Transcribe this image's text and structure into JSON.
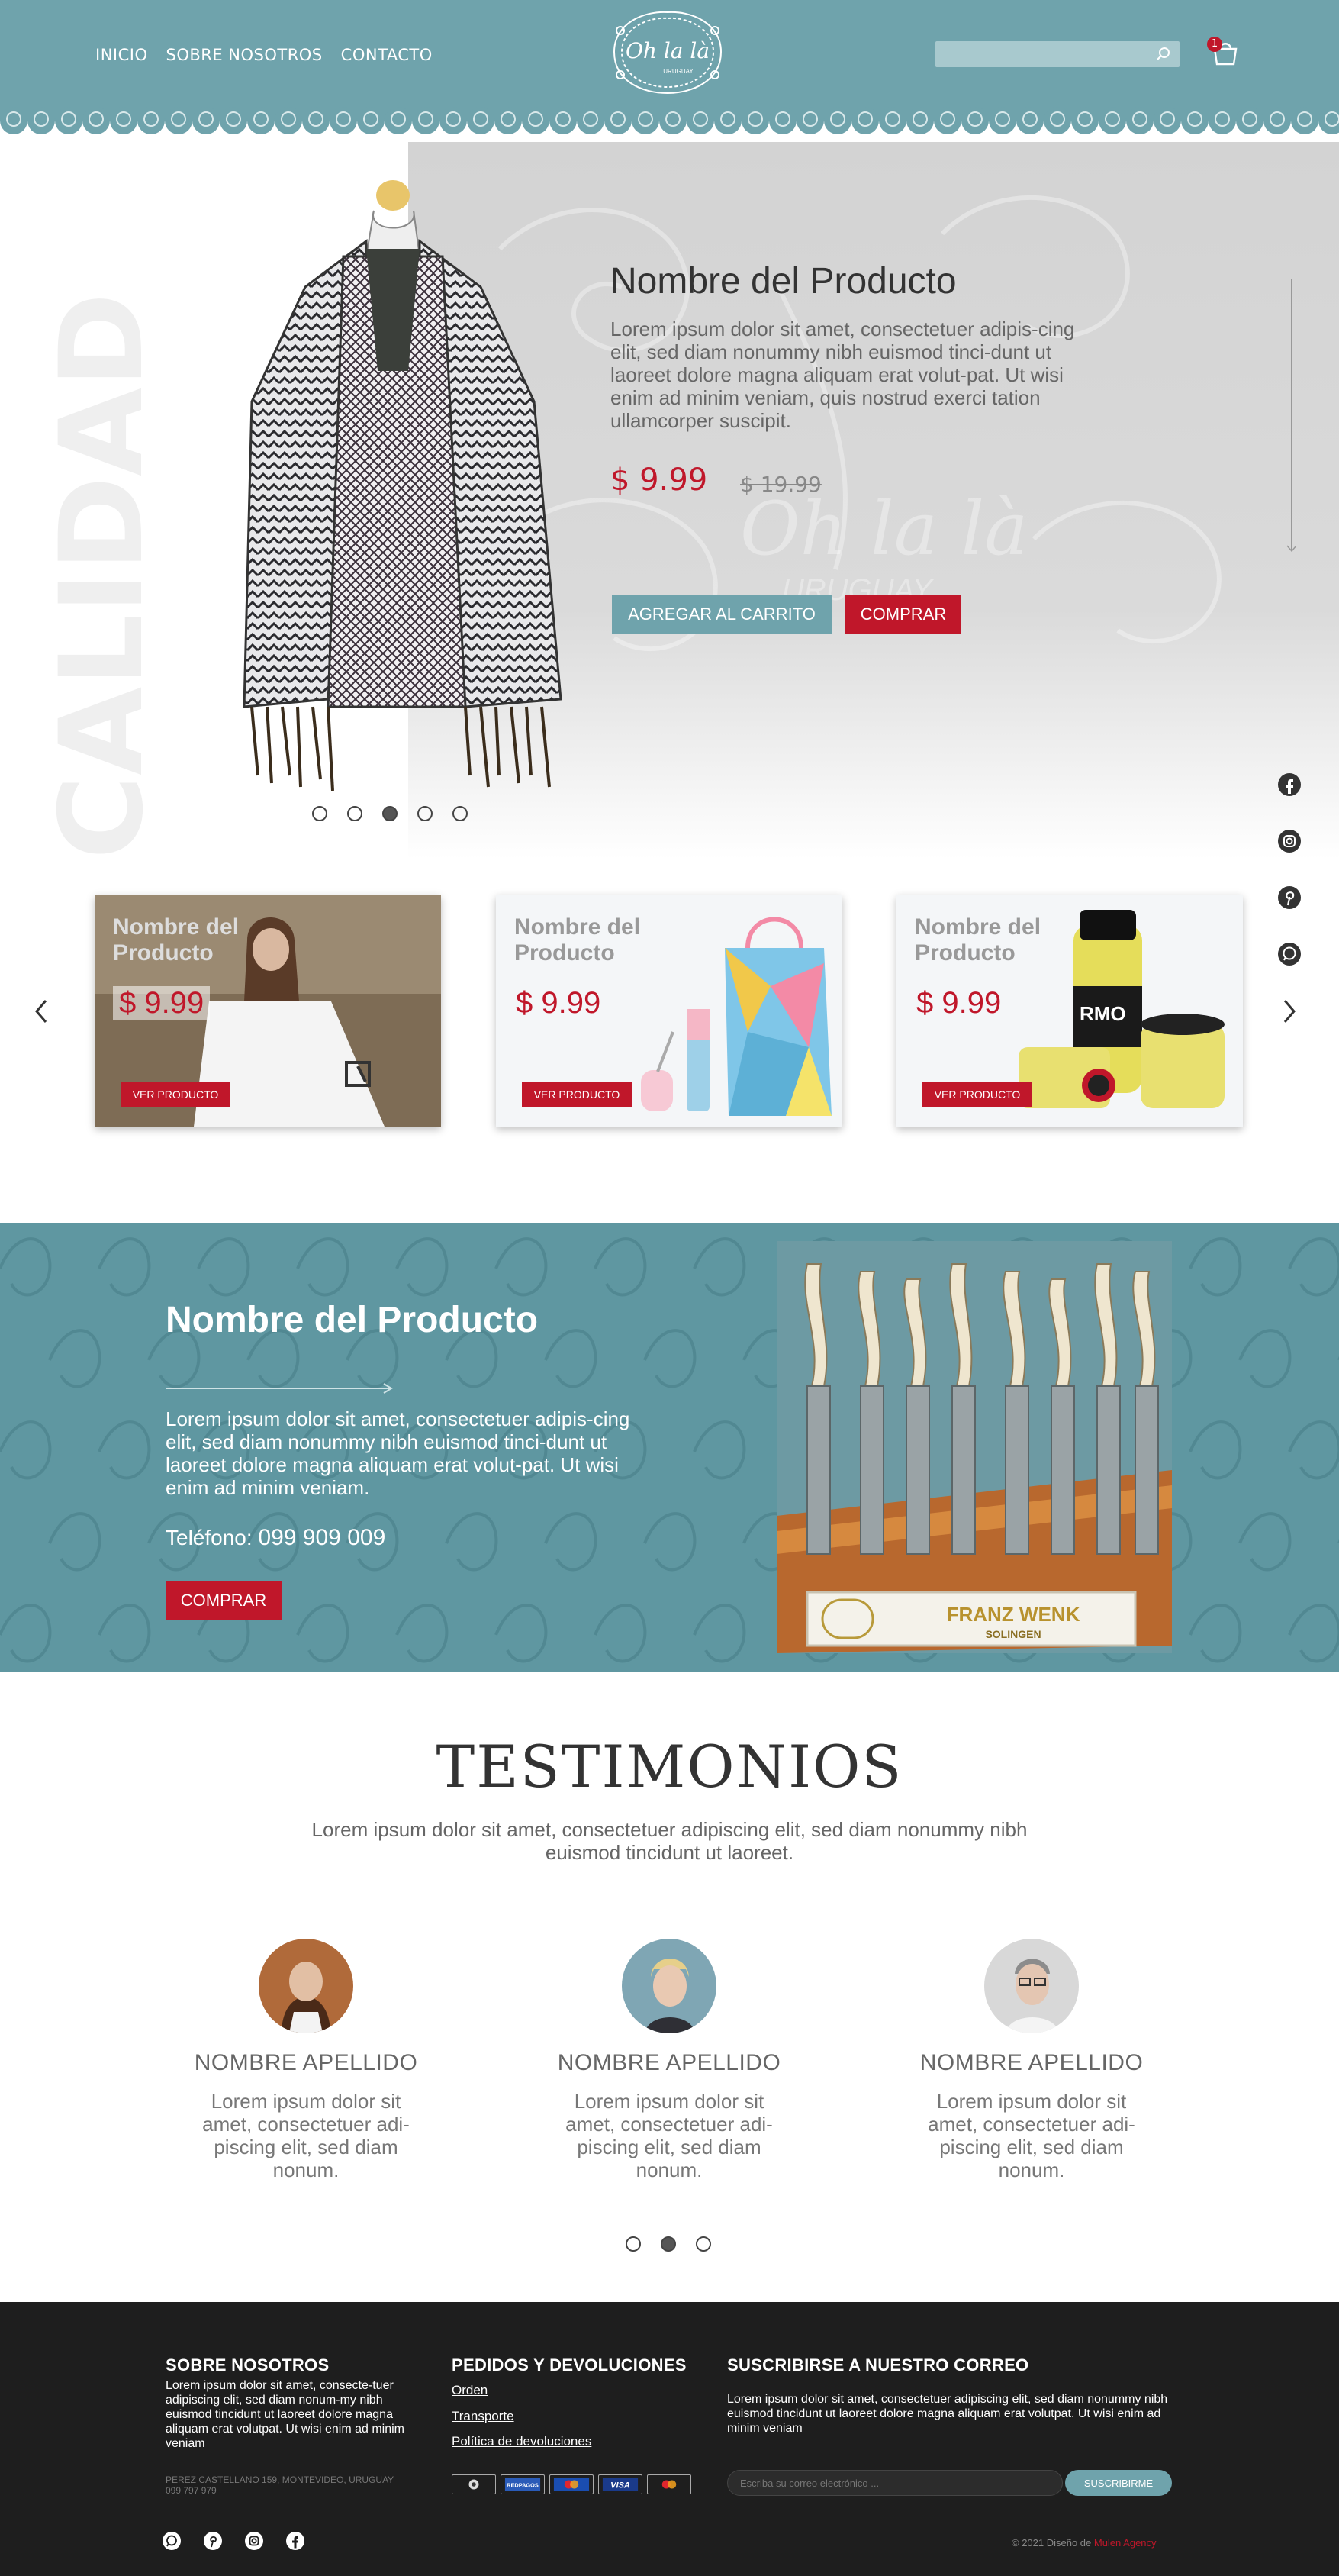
{
  "header": {
    "nav": [
      "INICIO",
      "SOBRE NOSOTROS",
      "CONTACTO"
    ],
    "logo_text": "Oh la là",
    "logo_sub": "URUGUAY",
    "search": {
      "placeholder": "",
      "icon": "search-icon"
    },
    "cart": {
      "count": "1",
      "icon": "shopping-bag-icon"
    }
  },
  "hero": {
    "side_word": "CALIDAD",
    "title": "Nombre del Producto",
    "description": "Lorem ipsum dolor sit amet, consectetuer adipis-cing elit, sed diam nonummy nibh euismod tinci-dunt ut laoreet dolore magna aliquam erat volut-pat. Ut wisi enim ad minim veniam, quis nostrud exerci tation ullamcorper suscipit.",
    "price": "$ 9.99",
    "old_price": "$ 19.99",
    "add_to_cart": "AGREGAR AL CARRITO",
    "buy": "COMPRAR",
    "watermark_text": "URUGUAY",
    "slides": 5,
    "active_slide": 3,
    "social": [
      "facebook-icon",
      "instagram-icon",
      "pinterest-icon",
      "whatsapp-icon"
    ]
  },
  "cards": [
    {
      "title": "Nombre del Producto",
      "price": "$ 9.99",
      "button": "VER PRODUCTO"
    },
    {
      "title": "Nombre del Producto",
      "price": "$ 9.99",
      "button": "VER PRODUCTO"
    },
    {
      "title": "Nombre del Producto",
      "price": "$ 9.99",
      "button": "VER PRODUCTO"
    }
  ],
  "feature": {
    "title": "Nombre del Producto",
    "description": "Lorem ipsum dolor sit amet, consectetuer adipis-cing elit, sed diam nonummy nibh euismod tinci-dunt ut laoreet dolore magna aliquam erat volut-pat. Ut wisi enim ad minim veniam.",
    "phone_label": "Teléfono: ",
    "phone": "099 909 009",
    "buy": "COMPRAR",
    "image_brand": "FRANZ WENK",
    "image_city": "SOLINGEN"
  },
  "testimonials": {
    "title": "TESTIMONIOS",
    "subtitle": "Lorem ipsum dolor sit amet, consectetuer adipiscing elit, sed diam nonummy nibh euismod tincidunt ut laoreet.",
    "people": [
      {
        "name": "NOMBRE APELLIDO",
        "text": "Lorem ipsum dolor sit amet, consectetuer adi-piscing elit, sed diam nonum."
      },
      {
        "name": "NOMBRE APELLIDO",
        "text": "Lorem ipsum dolor sit amet, consectetuer adi-piscing elit, sed diam nonum."
      },
      {
        "name": "NOMBRE APELLIDO",
        "text": "Lorem ipsum dolor sit amet, consectetuer adi-piscing elit, sed diam nonum."
      }
    ],
    "slides": 3,
    "active_slide": 2
  },
  "footer": {
    "about_title": "SOBRE NOSOTROS",
    "about_text": "Lorem ipsum dolor sit amet, consecte-tuer adipiscing elit, sed diam nonum-my nibh euismod tincidunt ut laoreet dolore magna aliquam erat volutpat. Ut wisi enim ad minim veniam",
    "address": "PEREZ CASTELLANO 159, MONTEVIDEO, URUGUAY",
    "phone": "099 797 979",
    "orders_title": "PEDIDOS Y DEVOLUCIONES",
    "orders_links": [
      "Orden",
      "Transporte",
      "Política de devoluciones"
    ],
    "newsletter_title": "SUSCRIBIRSE A NUESTRO CORREO",
    "newsletter_text": "Lorem ipsum dolor sit amet, consectetuer adipiscing elit, sed diam nonummy nibh euismod tincidunt ut laoreet dolore magna aliquam erat volutpat. Ut wisi enim ad minim veniam",
    "email_placeholder": "Escriba su correo electrónico ...",
    "subscribe": "SUSCRIBIRME",
    "payments": [
      "abitab-icon",
      "redpagos-icon",
      "mastercard-icon",
      "visa-icon",
      "mastercard-alt-icon"
    ],
    "payment_labels": [
      "REDPAGOS",
      "VISA"
    ],
    "copyright": "© 2021 Diseño de ",
    "agency": "Mulen Agency",
    "social": [
      "whatsapp-icon",
      "pinterest-icon",
      "instagram-icon",
      "facebook-icon"
    ]
  },
  "colors": {
    "teal": "#6fa3ac",
    "red": "#c0172a",
    "dark": "#1e1e1e"
  }
}
